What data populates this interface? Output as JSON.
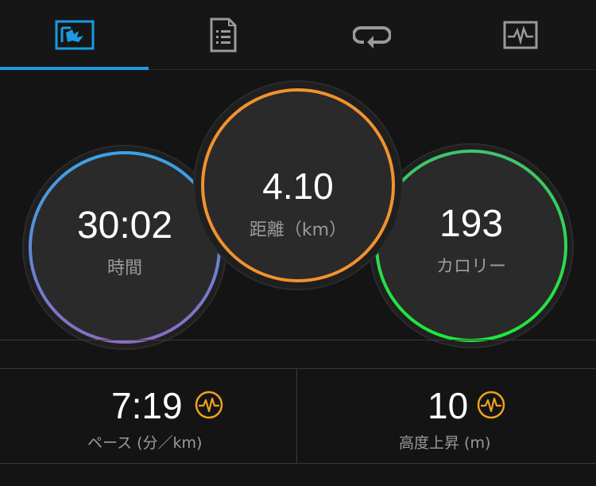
{
  "tabs": [
    {
      "name": "summary-icon",
      "active": true
    },
    {
      "name": "details-icon",
      "active": false
    },
    {
      "name": "laps-icon",
      "active": false
    },
    {
      "name": "graph-icon",
      "active": false
    }
  ],
  "colors": {
    "accent": "#1a9ae0",
    "time_ring_top": "#3aa3e6",
    "time_ring_bottom": "#8b6cc4",
    "distance_ring": "#f2922e",
    "calorie_ring_top": "#3fc56a",
    "calorie_ring_bottom": "#1ee83b",
    "heart_icon": "#f0a020"
  },
  "rings": {
    "time": {
      "value": "30:02",
      "label": "時間"
    },
    "distance": {
      "value": "4.10",
      "label": "距離（km）"
    },
    "calories": {
      "value": "193",
      "label": "カロリー"
    }
  },
  "stats": {
    "pace": {
      "value": "7:19",
      "label": "ペース (分／km)",
      "icon": "pulse-icon"
    },
    "elevation": {
      "value": "10",
      "label": "高度上昇 (m)",
      "icon": "pulse-icon"
    }
  }
}
